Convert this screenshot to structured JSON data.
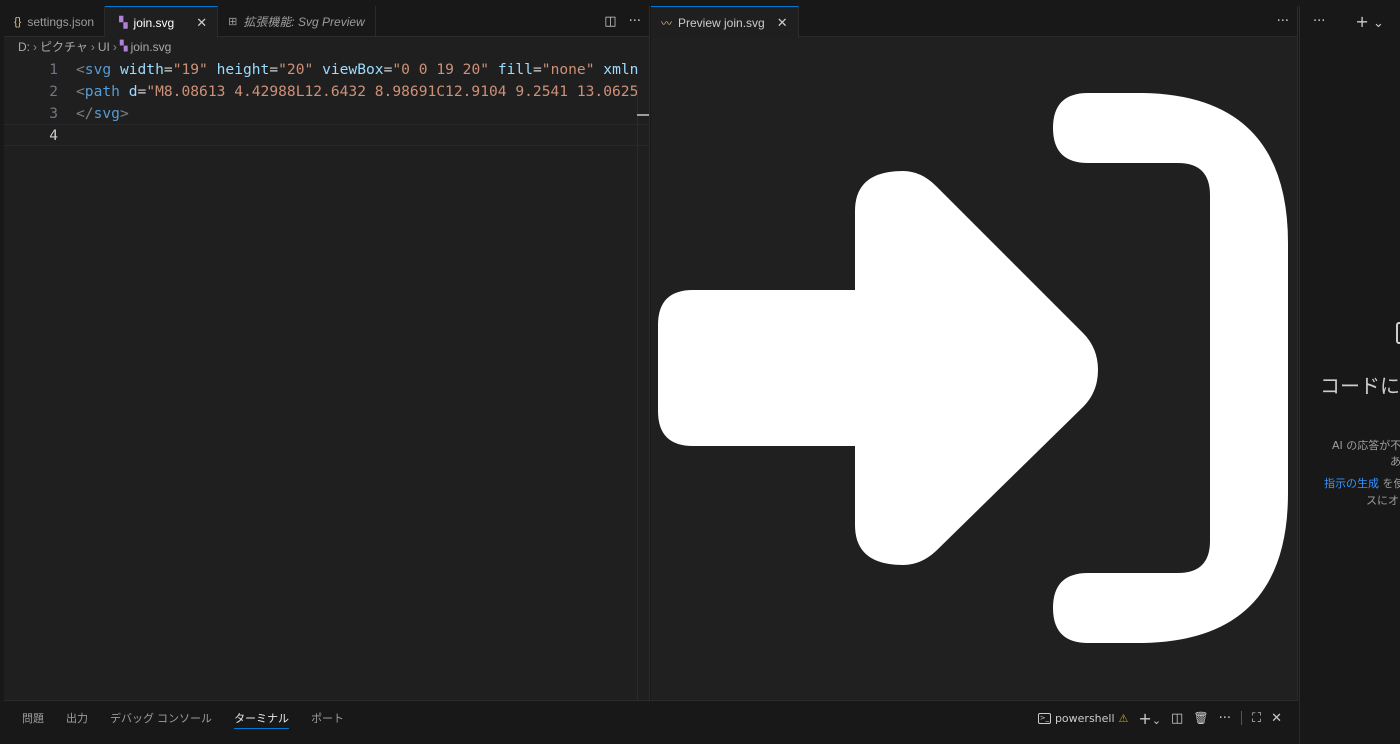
{
  "editor": {
    "tabs": [
      {
        "icon": "{}",
        "label": "settings.json"
      },
      {
        "icon": "▚",
        "label": "join.svg",
        "close": "✕"
      },
      {
        "icon": "⊞",
        "label": "拡張機能: Svg Preview"
      }
    ],
    "actions": {
      "split": "◫",
      "more": "···"
    },
    "breadcrumb": [
      "D:",
      "ピクチャ",
      "UI",
      "join.svg"
    ],
    "lines": [
      {
        "n": "1",
        "tokens": [
          [
            "t-br",
            "<"
          ],
          [
            "t-tag",
            "svg "
          ],
          [
            "t-attr",
            "width"
          ],
          [
            "t-eq",
            "="
          ],
          [
            "t-val",
            "\"19\" "
          ],
          [
            "t-attr",
            "height"
          ],
          [
            "t-eq",
            "="
          ],
          [
            "t-val",
            "\"20\" "
          ],
          [
            "t-attr",
            "viewBox"
          ],
          [
            "t-eq",
            "="
          ],
          [
            "t-val",
            "\"0 0 19 20\" "
          ],
          [
            "t-attr",
            "fill"
          ],
          [
            "t-eq",
            "="
          ],
          [
            "t-val",
            "\"none\" "
          ],
          [
            "t-attr",
            "xmln"
          ]
        ]
      },
      {
        "n": "2",
        "tokens": [
          [
            "t-br",
            "<"
          ],
          [
            "t-tag",
            "path "
          ],
          [
            "t-attr",
            "d"
          ],
          [
            "t-eq",
            "="
          ],
          [
            "t-val",
            "\"M8.08613 4.42988L12.6432 8.98691C12.9104 9.2541 13.0625"
          ]
        ]
      },
      {
        "n": "3",
        "tokens": [
          [
            "t-br",
            "</"
          ],
          [
            "t-tag",
            "svg"
          ],
          [
            "t-br",
            ">"
          ]
        ]
      },
      {
        "n": "4",
        "tokens": []
      }
    ]
  },
  "preview": {
    "tab_icon": "〰",
    "tab_label": "Preview join.svg",
    "tab_close": "✕",
    "more": "···"
  },
  "chat": {
    "more": "···",
    "plus": "+",
    "chevron": "⌄",
    "title": "コードに関",
    "note1": "AI の応答が不",
    "note2": "あ",
    "link": "指示の生成",
    "link_after": " を使",
    "note3": "スにオン"
  },
  "panel": {
    "tabs": [
      "問題",
      "出力",
      "デバッグ コンソール",
      "ターミナル",
      "ポート"
    ],
    "active_tab": "ターミナル",
    "shell_name": "powershell",
    "warn": "⚠",
    "plus": "+",
    "chevron": "⌄",
    "split": "◫",
    "trash": "🗑",
    "more": "···",
    "maximize": "⛶",
    "close": "✕"
  }
}
